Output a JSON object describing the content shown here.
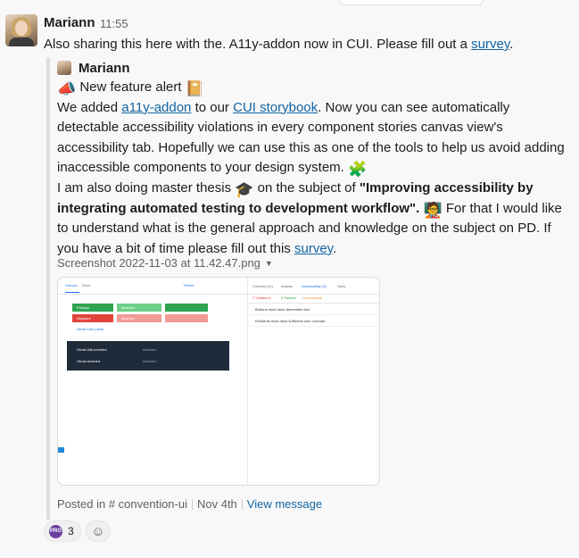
{
  "message": {
    "author": "Mariann",
    "time": "11:55",
    "intro_text": "Also sharing this here with the. A11y-addon now in CUI. Please fill out a ",
    "intro_link": "survey",
    "intro_end": "."
  },
  "quote": {
    "author": "Mariann",
    "alert_emoji_left": "📣",
    "alert_text": "New feature alert",
    "alert_emoji_right": "📔",
    "p1_a": "We added ",
    "p1_link1": "a11y-addon",
    "p1_b": " to our ",
    "p1_link2": "CUI storybook",
    "p1_c": ". Now you can see automatically detectable accessibility violations in every component stories canvas view's accessibility tab. Hopefully we can use this as one of the tools to help us avoid adding inaccessible components to your design system.",
    "p1_emoji": "🧩",
    "p2_a": "I am also doing master thesis ",
    "p2_emoji1": "🎓",
    "p2_b": " on the subject of ",
    "p2_bold": "\"Improving accessibility by integrating automated testing to development workflow\".",
    "p2_emoji2": "🧑‍🏫",
    "p2_c": " For that I would like to understand what is the general approach and knowledge on the subject on PD. If you have a bit of time please fill out this ",
    "p2_link": "survey",
    "p2_end": "."
  },
  "attachment": {
    "filename": "Screenshot 2022-11-03 at 11.42.47.png",
    "caret": "▼",
    "toolbar": [
      "Canvas",
      "Docs"
    ],
    "theme_label": "Theme",
    "panel_tabs": [
      "Controls (11)",
      "Actions",
      "Accessibility (3)",
      "Story"
    ],
    "sub_tabs": [
      "2 Violations",
      "0 Passes",
      "1 Incomplete"
    ],
    "violations": [
      "Buttons must have discernible text",
      "Elements must have sufficient color contrast"
    ],
    "buttons": {
      "primary": "Primary",
      "negative": "Negative",
      "ghost_link": "Ghost Link (new)",
      "disabled": "disabled",
      "ghost_link_inverted": "Ghost-link-inverted",
      "ghost_inverted": "Ghost-inverted"
    },
    "colors": {
      "green": "#2ea44f",
      "red": "#e0453b",
      "blue": "#1a73e8",
      "dark": "#1f2b3a"
    }
  },
  "footer": {
    "posted_in": "Posted in # convention-ui",
    "date": "Nov 4th",
    "view_message": "View message"
  },
  "reactions": [
    {
      "icon": "PRO",
      "count": "3"
    }
  ]
}
